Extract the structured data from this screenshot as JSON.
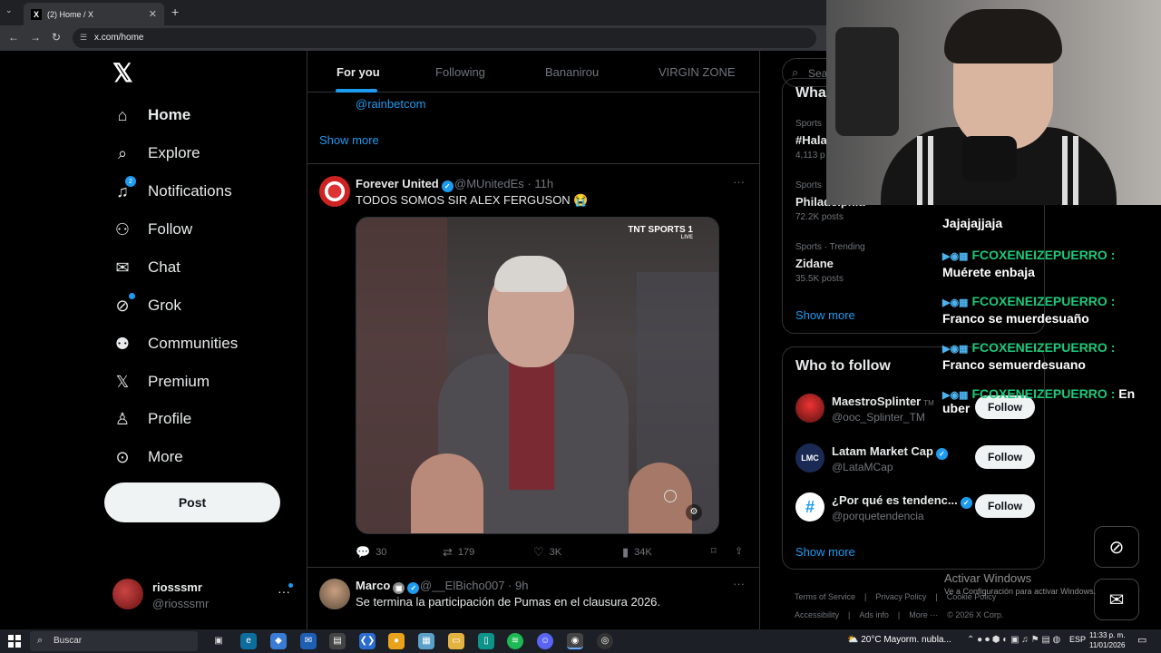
{
  "browser": {
    "tab_title": "(2) Home / X",
    "url": "x.com/home"
  },
  "sidebar": {
    "items": [
      {
        "label": "Home",
        "icon": "home-icon"
      },
      {
        "label": "Explore",
        "icon": "search-icon"
      },
      {
        "label": "Notifications",
        "icon": "bell-icon",
        "badge": "2"
      },
      {
        "label": "Follow",
        "icon": "person-plus-icon"
      },
      {
        "label": "Chat",
        "icon": "envelope-icon"
      },
      {
        "label": "Grok",
        "icon": "grok-icon"
      },
      {
        "label": "Communities",
        "icon": "people-icon"
      },
      {
        "label": "Premium",
        "icon": "x-icon"
      },
      {
        "label": "Profile",
        "icon": "person-icon"
      },
      {
        "label": "More",
        "icon": "more-circle-icon"
      }
    ],
    "post_label": "Post",
    "account": {
      "name": "riosssmr",
      "handle": "@riosssmr"
    }
  },
  "feed": {
    "tabs": [
      "For you",
      "Following",
      "Bananirou",
      "VIRGIN ZONE"
    ],
    "prev_link": "@rainbetcom",
    "show_more": "Show more",
    "tweet1": {
      "name": "Forever United",
      "meta": "@MUnitedEs · 11h",
      "text": "TODOS SOMOS SIR ALEX FERGUSON 😭",
      "media_brand": "TNT SPORTS 1",
      "media_sub": "LIVE",
      "replies": "30",
      "retweets": "179",
      "likes": "3K",
      "views": "34K"
    },
    "tweet2": {
      "name": "Marco",
      "meta": "@__ElBicho007 · 9h",
      "text": "Se termina la participación de Pumas en el clausura 2026."
    }
  },
  "right": {
    "search_placeholder": "Sea",
    "whats_title": "Wha",
    "trends": [
      {
        "category": "Sports",
        "name": "#Hala",
        "posts": "4,113 p"
      },
      {
        "category": "Sports",
        "name": "Philadelphia",
        "posts": "72.2K posts"
      },
      {
        "category": "Sports · Trending",
        "name": "Zidane",
        "posts": "35.5K posts"
      }
    ],
    "trends_show_more": "Show more",
    "who_to_follow": "Who to follow",
    "suggestions": [
      {
        "name": "MaestroSplinter",
        "suffix": "TM",
        "handle": "@ooc_Splinter_TM",
        "button": "Follow"
      },
      {
        "name": "Latam Market Cap",
        "handle": "@LataMCap",
        "button": "Follow"
      },
      {
        "name": "¿Por qué es tendenc...",
        "handle": "@porquetendencia",
        "button": "Follow"
      }
    ],
    "wtf_show_more": "Show more",
    "footer": [
      "Terms of Service",
      "|",
      "Privacy Policy",
      "|",
      "Cookie Policy",
      "Accessibility",
      "|",
      "Ads info",
      "|",
      "More ···",
      "© 2026 X Corp."
    ]
  },
  "chat": {
    "messages": [
      {
        "user": "FCOXENEIZEPUERRO :",
        "text": "Jajajajjaja"
      },
      {
        "user": "FCOXENEIZEPUERRO :",
        "text": "Muérete enbaja"
      },
      {
        "user": "FCOXENEIZEPUERRO :",
        "text": "Franco se muerdesuaño"
      },
      {
        "user": "FCOXENEIZEPUERRO :",
        "text": "Franco semuerdesuano"
      },
      {
        "user": "FCOXENEIZEPUERRO :",
        "text": "En uber"
      }
    ]
  },
  "windows_watermark": {
    "title": "Activar Windows",
    "subtitle": "Ve a Configuración para activar Windows."
  },
  "taskbar": {
    "search_label": "Buscar",
    "weather": "20°C  Mayorm. nubla...",
    "lang": "ESP",
    "time": "11:33 p. m.",
    "date": "11/01/2026"
  }
}
